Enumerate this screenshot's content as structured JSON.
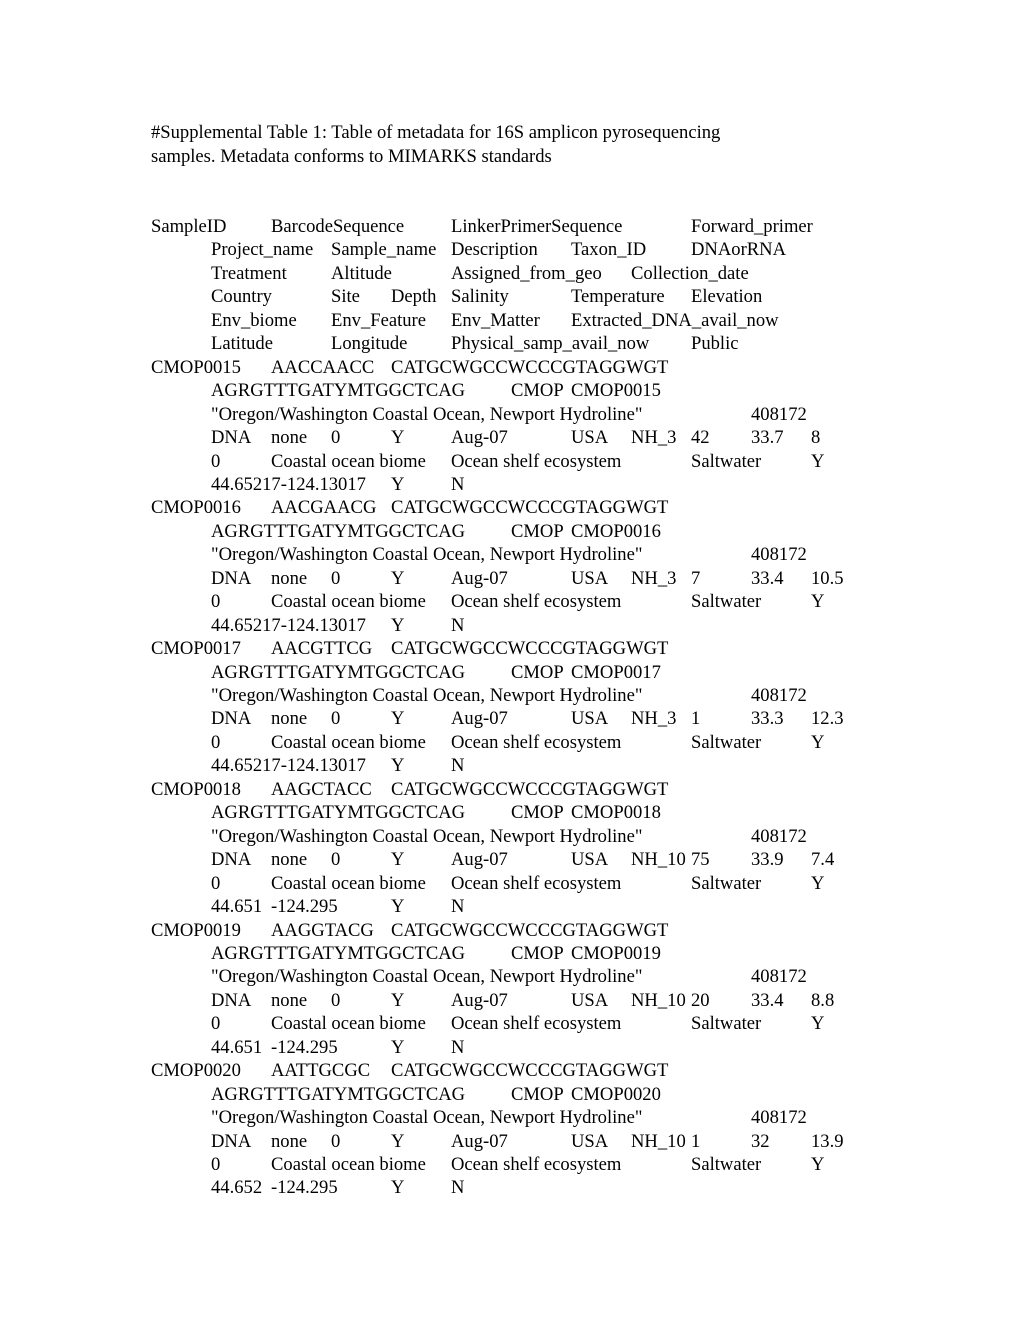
{
  "caption": {
    "line1": "#Supplemental Table 1: Table of metadata for 16S amplicon pyrosequencing",
    "line2": "samples. Metadata conforms to MIMARKS standards"
  },
  "header_lines": [
    [
      "SampleID",
      "BarcodeSequence",
      "LinkerPrimerSequence",
      "Forward_primer"
    ],
    [
      "Project_name",
      "Sample_name",
      "Description",
      "Taxon_ID",
      "DNAorRNA"
    ],
    [
      "Treatment",
      "Altitude",
      "Assigned_from_geo",
      "Collection_date"
    ],
    [
      "Country",
      "Site",
      "Depth",
      "Salinity",
      "Temperature",
      "Elevation"
    ],
    [
      "Env_biome",
      "Env_Feature",
      "Env_Matter",
      "Extracted_DNA_avail_now"
    ],
    [
      "Latitude",
      "Longitude",
      "Physical_samp_avail_now",
      "Public"
    ]
  ],
  "records": [
    {
      "SampleID": "CMOP0015",
      "BarcodeSequence": "AACCAACC",
      "LinkerPrimerSequence": "CATGCWGCCWCCCGTAGGWGT",
      "Forward_primer": "AGRGTTTGATYMTGGCTCAG",
      "Project_name": "CMOP",
      "Sample_name": "CMOP0015",
      "Description": "\"Oregon/Washington Coastal Ocean, Newport Hydroline\"",
      "Taxon_ID": "408172",
      "DNAorRNA": "DNA",
      "Treatment": "none",
      "Altitude": "0",
      "Assigned_from_geo": "Y",
      "Collection_date": "Aug-07",
      "Country": "USA",
      "Site": "NH_3",
      "Depth": "42",
      "Salinity": "33.7",
      "Temperature": "8",
      "Elevation": "0",
      "Env_biome": "Coastal ocean biome",
      "Env_Feature": "Ocean shelf ecosystem",
      "Env_Matter": "Saltwater",
      "Extracted_DNA_avail_now": "Y",
      "Latitude": "44.65217",
      "Longitude": "-124.13017",
      "Physical_samp_avail_now": "Y",
      "Public": "N"
    },
    {
      "SampleID": "CMOP0016",
      "BarcodeSequence": "AACGAACG",
      "LinkerPrimerSequence": "CATGCWGCCWCCCGTAGGWGT",
      "Forward_primer": "AGRGTTTGATYMTGGCTCAG",
      "Project_name": "CMOP",
      "Sample_name": "CMOP0016",
      "Description": "\"Oregon/Washington Coastal Ocean, Newport Hydroline\"",
      "Taxon_ID": "408172",
      "DNAorRNA": "DNA",
      "Treatment": "none",
      "Altitude": "0",
      "Assigned_from_geo": "Y",
      "Collection_date": "Aug-07",
      "Country": "USA",
      "Site": "NH_3",
      "Depth": "7",
      "Salinity": "33.4",
      "Temperature": "10.5",
      "Elevation": "0",
      "Env_biome": "Coastal ocean biome",
      "Env_Feature": "Ocean shelf ecosystem",
      "Env_Matter": "Saltwater",
      "Extracted_DNA_avail_now": "Y",
      "Latitude": "44.65217",
      "Longitude": "-124.13017",
      "Physical_samp_avail_now": "Y",
      "Public": "N"
    },
    {
      "SampleID": "CMOP0017",
      "BarcodeSequence": "AACGTTCG",
      "LinkerPrimerSequence": "CATGCWGCCWCCCGTAGGWGT",
      "Forward_primer": "AGRGTTTGATYMTGGCTCAG",
      "Project_name": "CMOP",
      "Sample_name": "CMOP0017",
      "Description": "\"Oregon/Washington Coastal Ocean, Newport Hydroline\"",
      "Taxon_ID": "408172",
      "DNAorRNA": "DNA",
      "Treatment": "none",
      "Altitude": "0",
      "Assigned_from_geo": "Y",
      "Collection_date": "Aug-07",
      "Country": "USA",
      "Site": "NH_3",
      "Depth": "1",
      "Salinity": "33.3",
      "Temperature": "12.3",
      "Elevation": "0",
      "Env_biome": "Coastal ocean biome",
      "Env_Feature": "Ocean shelf ecosystem",
      "Env_Matter": "Saltwater",
      "Extracted_DNA_avail_now": "Y",
      "Latitude": "44.65217",
      "Longitude": "-124.13017",
      "Physical_samp_avail_now": "Y",
      "Public": "N"
    },
    {
      "SampleID": "CMOP0018",
      "BarcodeSequence": "AAGCTACC",
      "LinkerPrimerSequence": "CATGCWGCCWCCCGTAGGWGT",
      "Forward_primer": "AGRGTTTGATYMTGGCTCAG",
      "Project_name": "CMOP",
      "Sample_name": "CMOP0018",
      "Description": "\"Oregon/Washington Coastal Ocean, Newport Hydroline\"",
      "Taxon_ID": "408172",
      "DNAorRNA": "DNA",
      "Treatment": "none",
      "Altitude": "0",
      "Assigned_from_geo": "Y",
      "Collection_date": "Aug-07",
      "Country": "USA",
      "Site": "NH_10",
      "Depth": "75",
      "Salinity": "33.9",
      "Temperature": "7.4",
      "Elevation": "0",
      "Env_biome": "Coastal ocean biome",
      "Env_Feature": "Ocean shelf ecosystem",
      "Env_Matter": "Saltwater",
      "Extracted_DNA_avail_now": "Y",
      "Latitude": "44.651",
      "Longitude": "-124.295",
      "Physical_samp_avail_now": "Y",
      "Public": "N"
    },
    {
      "SampleID": "CMOP0019",
      "BarcodeSequence": "AAGGTACG",
      "LinkerPrimerSequence": "CATGCWGCCWCCCGTAGGWGT",
      "Forward_primer": "AGRGTTTGATYMTGGCTCAG",
      "Project_name": "CMOP",
      "Sample_name": "CMOP0019",
      "Description": "\"Oregon/Washington Coastal Ocean, Newport Hydroline\"",
      "Taxon_ID": "408172",
      "DNAorRNA": "DNA",
      "Treatment": "none",
      "Altitude": "0",
      "Assigned_from_geo": "Y",
      "Collection_date": "Aug-07",
      "Country": "USA",
      "Site": "NH_10",
      "Depth": "20",
      "Salinity": "33.4",
      "Temperature": "8.8",
      "Elevation": "0",
      "Env_biome": "Coastal ocean biome",
      "Env_Feature": "Ocean shelf ecosystem",
      "Env_Matter": "Saltwater",
      "Extracted_DNA_avail_now": "Y",
      "Latitude": "44.651",
      "Longitude": "-124.295",
      "Physical_samp_avail_now": "Y",
      "Public": "N"
    },
    {
      "SampleID": "CMOP0020",
      "BarcodeSequence": "AATTGCGC",
      "LinkerPrimerSequence": "CATGCWGCCWCCCGTAGGWGT",
      "Forward_primer": "AGRGTTTGATYMTGGCTCAG",
      "Project_name": "CMOP",
      "Sample_name": "CMOP0020",
      "Description": "\"Oregon/Washington Coastal Ocean, Newport Hydroline\"",
      "Taxon_ID": "408172",
      "DNAorRNA": "DNA",
      "Treatment": "none",
      "Altitude": "0",
      "Assigned_from_geo": "Y",
      "Collection_date": "Aug-07",
      "Country": "USA",
      "Site": "NH_10",
      "Depth": "1",
      "Salinity": "32",
      "Temperature": "13.9",
      "Elevation": "0",
      "Env_biome": "Coastal ocean biome",
      "Env_Feature": "Ocean shelf ecosystem",
      "Env_Matter": "Saltwater",
      "Extracted_DNA_avail_now": "Y",
      "Latitude": "44.652",
      "Longitude": "-124.295",
      "Physical_samp_avail_now": "Y",
      "Public": "N"
    }
  ]
}
